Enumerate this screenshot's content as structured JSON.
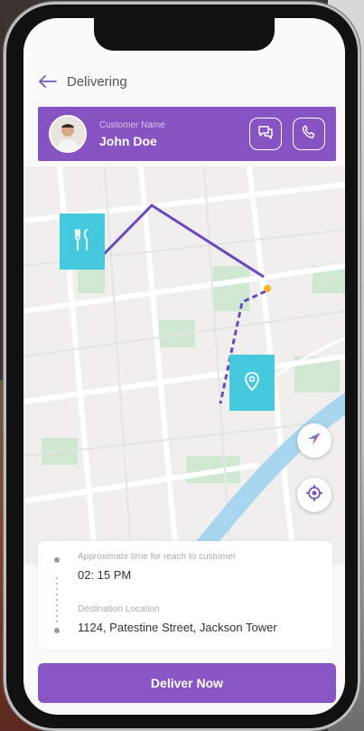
{
  "header": {
    "title": "Delivering",
    "back_icon": "arrow-left-icon"
  },
  "customer": {
    "label": "Customer Name",
    "name": "John Doe",
    "chat_icon": "chat-icon",
    "call_icon": "phone-icon"
  },
  "map": {
    "restaurant_icon": "fork-knife-icon",
    "destination_icon": "location-pin-icon",
    "compass_icon": "compass-icon",
    "locate_icon": "target-icon",
    "route_color": "#6b48c0",
    "marker_color": "#45c9dd"
  },
  "delivery_info": {
    "time_label": "Approximate time for reach to customer",
    "time_value": "02: 15 PM",
    "destination_label": "Destination Location",
    "destination_value": "1124, Patestine Street, Jackson Tower"
  },
  "actions": {
    "deliver_label": "Deliver Now"
  },
  "colors": {
    "accent": "#8753c2",
    "marker": "#45c9dd"
  }
}
